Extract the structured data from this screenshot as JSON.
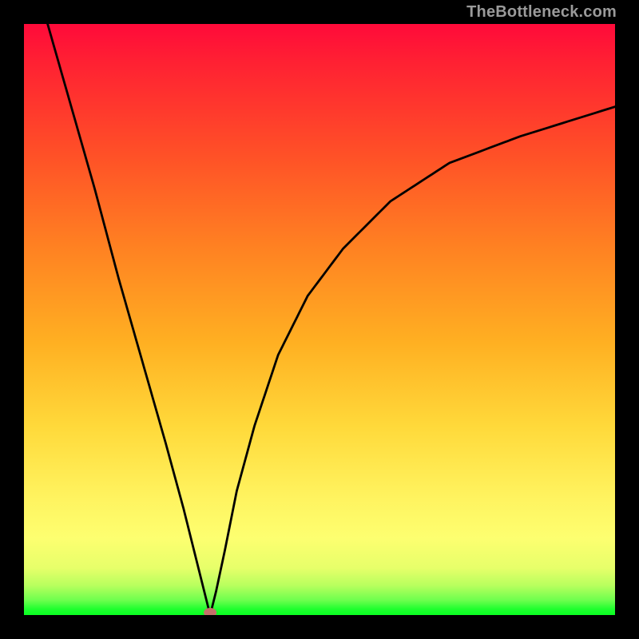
{
  "watermark": {
    "text": "TheBottleneck.com"
  },
  "chart_data": {
    "type": "line",
    "title": "",
    "xlabel": "",
    "ylabel": "",
    "xlim": [
      0,
      100
    ],
    "ylim": [
      0,
      100
    ],
    "grid": false,
    "legend": false,
    "background_gradient": {
      "direction": "vertical",
      "stops": [
        {
          "pos": 0.0,
          "color": "#ff0a3a"
        },
        {
          "pos": 0.22,
          "color": "#ff5027"
        },
        {
          "pos": 0.54,
          "color": "#ffb022"
        },
        {
          "pos": 0.8,
          "color": "#fff35f"
        },
        {
          "pos": 0.95,
          "color": "#b8ff5e"
        },
        {
          "pos": 1.0,
          "color": "#0aff22"
        }
      ]
    },
    "min_point": {
      "x": 31.5,
      "y": 0
    },
    "series": [
      {
        "name": "bottleneck-curve",
        "x": [
          4,
          8,
          12,
          16,
          20,
          24,
          27,
          29,
          30.5,
          31.5,
          32.5,
          34,
          36,
          39,
          43,
          48,
          54,
          62,
          72,
          84,
          100
        ],
        "y": [
          100,
          86,
          72,
          57,
          43,
          29,
          18,
          10,
          4,
          0,
          4,
          11,
          21,
          32,
          44,
          54,
          62,
          70,
          76.5,
          81,
          86
        ]
      }
    ]
  }
}
